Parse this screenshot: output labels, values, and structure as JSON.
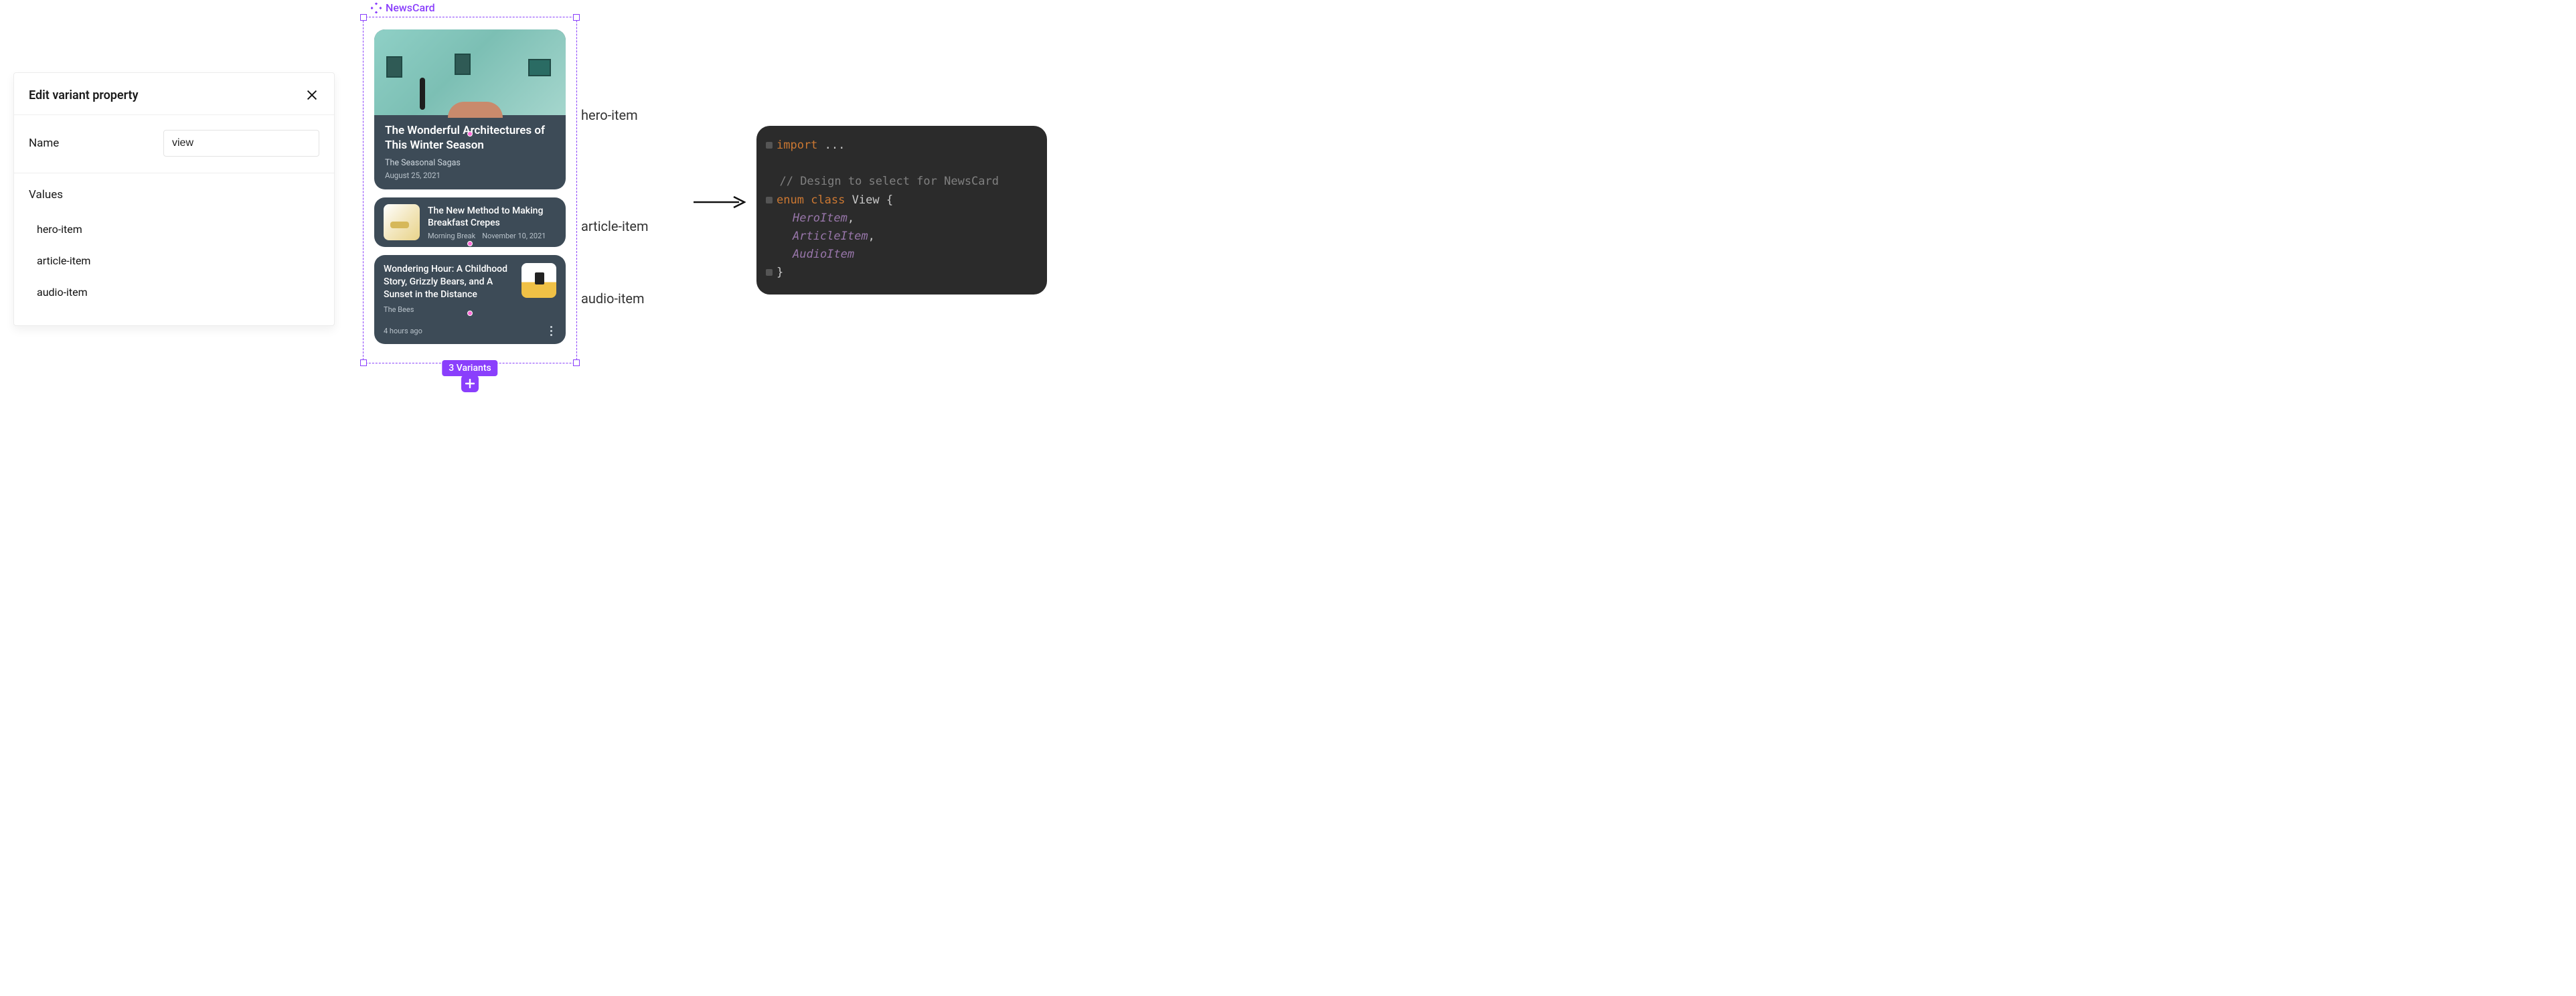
{
  "panel": {
    "title": "Edit variant property",
    "name_label": "Name",
    "name_value": "view",
    "values_label": "Values",
    "values": [
      "hero-item",
      "article-item",
      "audio-item"
    ]
  },
  "frame": {
    "component_name": "NewsCard",
    "variants_badge": "3 Variants",
    "cards": {
      "hero": {
        "title": "The Wonderful Architectures of This Winter Season",
        "source": "The Seasonal Sagas",
        "date": "August 25, 2021"
      },
      "article": {
        "title": "The New Method to Making Breakfast Crepes",
        "source": "Morning Break",
        "date": "November 10, 2021"
      },
      "audio": {
        "title": "Wondering Hour: A Childhood Story, Grizzly Bears, and A Sunset in the Distance",
        "source": "The Bees",
        "ago": "4 hours ago"
      }
    }
  },
  "variant_labels": {
    "hero": "hero-item",
    "article": "article-item",
    "audio": "audio-item"
  },
  "code": {
    "import_kw": "import",
    "import_rest": " ...",
    "comment": "// Design to select for NewsCard",
    "enum_kw": "enum",
    "class_kw": "class",
    "type_name": "View",
    "open_brace": " {",
    "vals": [
      "HeroItem",
      "ArticleItem",
      "AudioItem"
    ],
    "close_brace": "}"
  }
}
